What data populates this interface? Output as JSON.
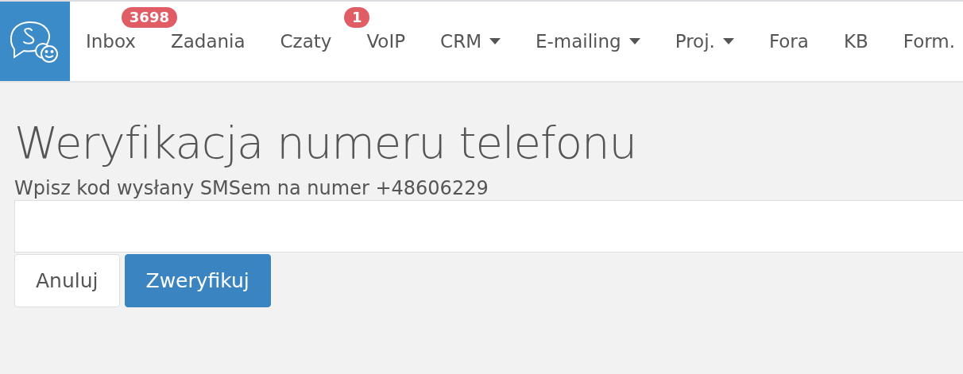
{
  "nav": {
    "items": [
      {
        "label": "Inbox",
        "badge": "3698",
        "dropdown": false
      },
      {
        "label": "Zadania",
        "dropdown": false
      },
      {
        "label": "Czaty",
        "badge": "1",
        "dropdown": false
      },
      {
        "label": "VoIP",
        "dropdown": false
      },
      {
        "label": "CRM",
        "dropdown": true
      },
      {
        "label": "E-mailing",
        "dropdown": true
      },
      {
        "label": "Proj.",
        "dropdown": true
      },
      {
        "label": "Fora",
        "dropdown": false
      },
      {
        "label": "KB",
        "dropdown": false
      },
      {
        "label": "Form.",
        "dropdown": false
      }
    ]
  },
  "page": {
    "title": "Weryfikacja numeru telefonu",
    "label": "Wpisz kod wysłany SMSem na numer +48606229",
    "buttons": [
      {
        "label": "Anuluj",
        "kind": "default"
      },
      {
        "label": "Zweryfikuj",
        "kind": "primary"
      }
    ]
  }
}
